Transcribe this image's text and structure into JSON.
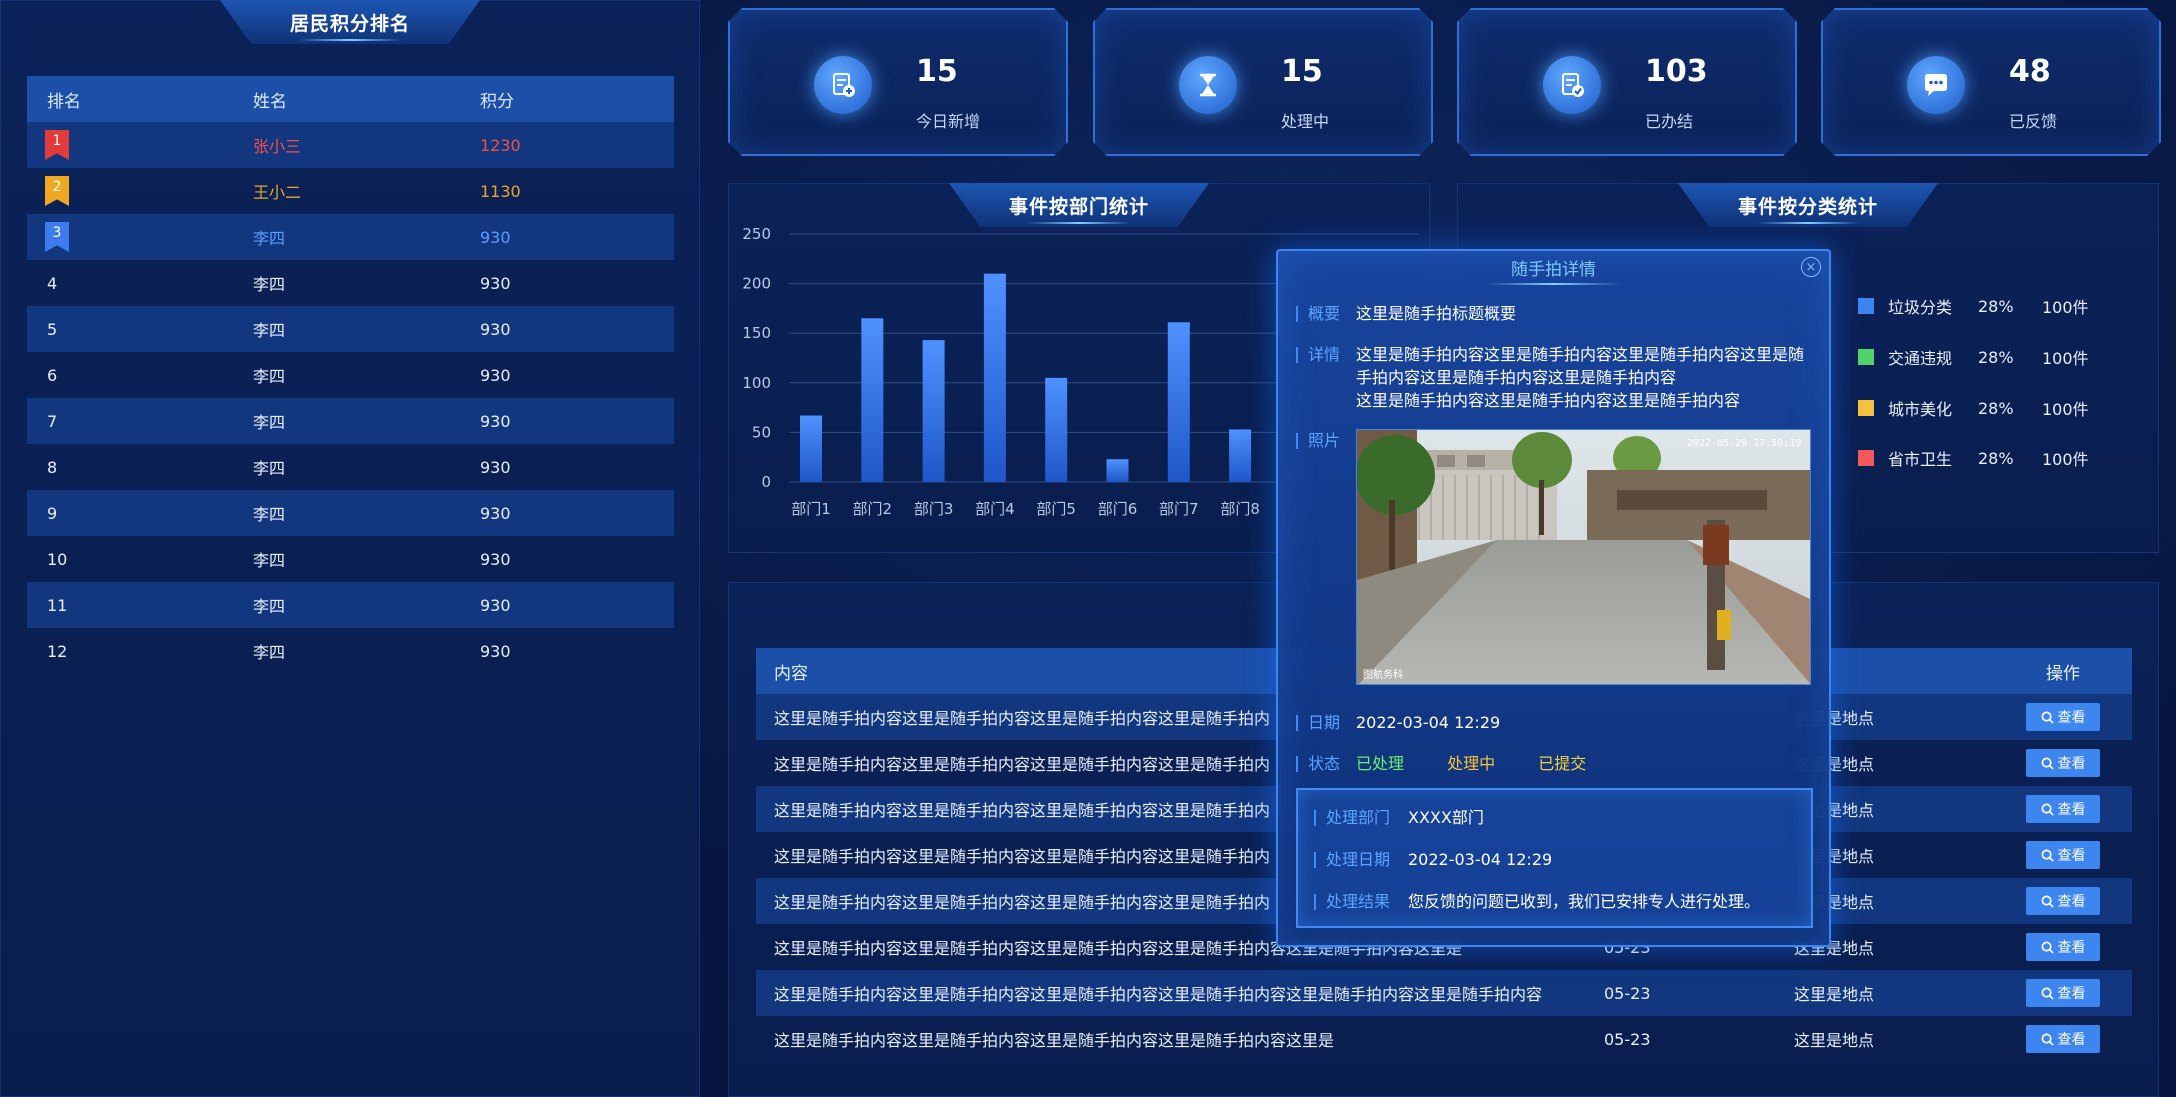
{
  "ranking": {
    "title": "居民积分排名",
    "headers": {
      "rank": "排名",
      "name": "姓名",
      "score": "积分"
    },
    "rows": [
      {
        "rank": "1",
        "name": "张小三",
        "score": "1230"
      },
      {
        "rank": "2",
        "name": "王小二",
        "score": "1130"
      },
      {
        "rank": "3",
        "name": "李四",
        "score": "930"
      },
      {
        "rank": "4",
        "name": "李四",
        "score": "930"
      },
      {
        "rank": "5",
        "name": "李四",
        "score": "930"
      },
      {
        "rank": "6",
        "name": "李四",
        "score": "930"
      },
      {
        "rank": "7",
        "name": "李四",
        "score": "930"
      },
      {
        "rank": "8",
        "name": "李四",
        "score": "930"
      },
      {
        "rank": "9",
        "name": "李四",
        "score": "930"
      },
      {
        "rank": "10",
        "name": "李四",
        "score": "930"
      },
      {
        "rank": "11",
        "name": "李四",
        "score": "930"
      },
      {
        "rank": "12",
        "name": "李四",
        "score": "930"
      }
    ]
  },
  "stats": [
    {
      "value": "15",
      "label": "今日新增",
      "icon": "document-plus-icon"
    },
    {
      "value": "15",
      "label": "处理中",
      "icon": "hourglass-icon"
    },
    {
      "value": "103",
      "label": "已办结",
      "icon": "document-check-icon"
    },
    {
      "value": "48",
      "label": "已反馈",
      "icon": "chat-bubble-icon"
    }
  ],
  "dept_panel": {
    "title": "事件按部门统计"
  },
  "category_panel": {
    "title": "事件按分类统计",
    "legend": [
      {
        "name": "垃圾分类",
        "pct": "28%",
        "count": "100件",
        "color": "#3d86f0"
      },
      {
        "name": "交通违规",
        "pct": "28%",
        "count": "100件",
        "color": "#4fd36a"
      },
      {
        "name": "城市美化",
        "pct": "28%",
        "count": "100件",
        "color": "#f4c23b"
      },
      {
        "name": "省市卫生",
        "pct": "28%",
        "count": "100件",
        "color": "#f25a5a"
      }
    ]
  },
  "chart_data": {
    "type": "bar",
    "categories": [
      "部门1",
      "部门2",
      "部门3",
      "部门4",
      "部门5",
      "部门6",
      "部门7",
      "部门8"
    ],
    "values": [
      67,
      165,
      143,
      210,
      105,
      23,
      161,
      53
    ],
    "yticks": [
      0,
      50,
      100,
      150,
      200,
      250
    ],
    "ylim": [
      0,
      250
    ],
    "grid": true,
    "bar_color": "#3a7df0"
  },
  "events": {
    "headers": {
      "content": "内容",
      "date": "",
      "place": "点",
      "action": "操作"
    },
    "rows": [
      {
        "content": "这里是随手拍内容这里是随手拍内容这里是随手拍内容这里是随手拍内",
        "date": "",
        "place": "这里是地点",
        "action": "查看"
      },
      {
        "content": "这里是随手拍内容这里是随手拍内容这里是随手拍内容这里是随手拍内",
        "date": "",
        "place": "这里是地点",
        "action": "查看"
      },
      {
        "content": "这里是随手拍内容这里是随手拍内容这里是随手拍内容这里是随手拍内",
        "date": "",
        "place": "这里是地点",
        "action": "查看"
      },
      {
        "content": "这里是随手拍内容这里是随手拍内容这里是随手拍内容这里是随手拍内",
        "date": "",
        "place": "这里是地点",
        "action": "查看"
      },
      {
        "content": "这里是随手拍内容这里是随手拍内容这里是随手拍内容这里是随手拍内",
        "date": "",
        "place": "这里是地点",
        "action": "查看"
      },
      {
        "content": "这里是随手拍内容这里是随手拍内容这里是随手拍内容这里是随手拍内容这里是随手拍内容这里是",
        "date": "05-23",
        "place": "这里是地点",
        "action": "查看"
      },
      {
        "content": "这里是随手拍内容这里是随手拍内容这里是随手拍内容这里是随手拍内容这里是随手拍内容这里是随手拍内容",
        "date": "05-23",
        "place": "这里是地点",
        "action": "查看"
      },
      {
        "content": "这里是随手拍内容这里是随手拍内容这里是随手拍内容这里是随手拍内容这里是",
        "date": "05-23",
        "place": "这里是地点",
        "action": "查看"
      }
    ]
  },
  "modal": {
    "title": "随手拍详情",
    "close": "×",
    "summary_label": "概要",
    "summary": "这里是随手拍标题概要",
    "detail_label": "详情",
    "detail_line1": "这里是随手拍内容这里是随手拍内容这里是随手拍内容这里是随",
    "detail_line2": "手拍内容这里是随手拍内容这里是随手拍内容",
    "detail_line3": "这里是随手拍内容这里是随手拍内容这里是随手拍内容",
    "photo_label": "照片",
    "photo_stamp": "2022-05-29 17:50:19",
    "photo_caption": "图航务科",
    "date_label": "日期",
    "date": "2022-03-04 12:29",
    "status_label": "状态",
    "status_done": "已处理",
    "status_processing": "处理中",
    "status_submitted": "已提交",
    "dept_label": "处理部门",
    "dept": "XXXX部门",
    "handle_date_label": "处理日期",
    "handle_date": "2022-03-04 12:29",
    "result_label": "处理结果",
    "result": "您反馈的问题已收到，我们已安排专人进行处理。"
  }
}
